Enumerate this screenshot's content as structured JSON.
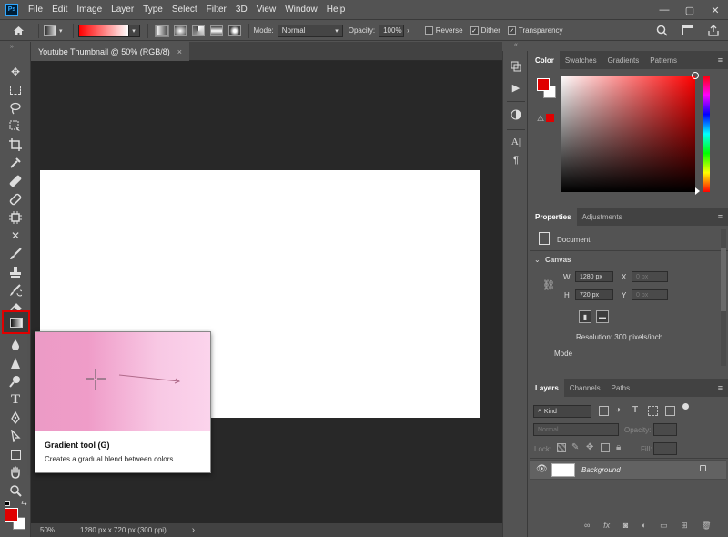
{
  "menubar": {
    "logo": "Ps",
    "items": [
      "File",
      "Edit",
      "Image",
      "Layer",
      "Type",
      "Select",
      "Filter",
      "3D",
      "View",
      "Window",
      "Help"
    ],
    "window_controls": [
      "—",
      "▢",
      "✕"
    ]
  },
  "options": {
    "mode_label": "Mode:",
    "mode_value": "Normal",
    "opacity_label": "Opacity:",
    "opacity_value": "100%",
    "reverse_label": "Reverse",
    "dither_label": "Dither",
    "transparency_label": "Transparency",
    "reverse_checked": false,
    "dither_checked": true,
    "transparency_checked": true
  },
  "document": {
    "tab_title": "Youtube Thumbnail @ 50% (RGB/8)",
    "zoom": "50%",
    "info": "1280 px x 720 px (300 ppi)"
  },
  "tooltip": {
    "title": "Gradient tool (G)",
    "description": "Creates a gradual blend between colors"
  },
  "color_panel": {
    "tabs": [
      "Color",
      "Swatches",
      "Gradients",
      "Patterns"
    ],
    "foreground": "#e00000",
    "background": "#ffffff"
  },
  "properties": {
    "tabs": [
      "Properties",
      "Adjustments"
    ],
    "document_label": "Document",
    "canvas_label": "Canvas",
    "w_label": "W",
    "w_value": "1280 px",
    "h_label": "H",
    "h_value": "720 px",
    "x_label": "X",
    "x_value": "0 px",
    "y_label": "Y",
    "y_value": "0 px",
    "resolution": "Resolution: 300 pixels/inch",
    "mode_label": "Mode"
  },
  "layers": {
    "tabs": [
      "Layers",
      "Channels",
      "Paths"
    ],
    "kind_placeholder": "Kind",
    "blend_mode": "Normal",
    "opacity_label": "Opacity:",
    "lock_label": "Lock:",
    "fill_label": "Fill:",
    "layer_name": "Background"
  },
  "colors": {
    "accent_red": "#e00000",
    "panel_bg": "#535353",
    "workspace_bg": "#282828"
  }
}
